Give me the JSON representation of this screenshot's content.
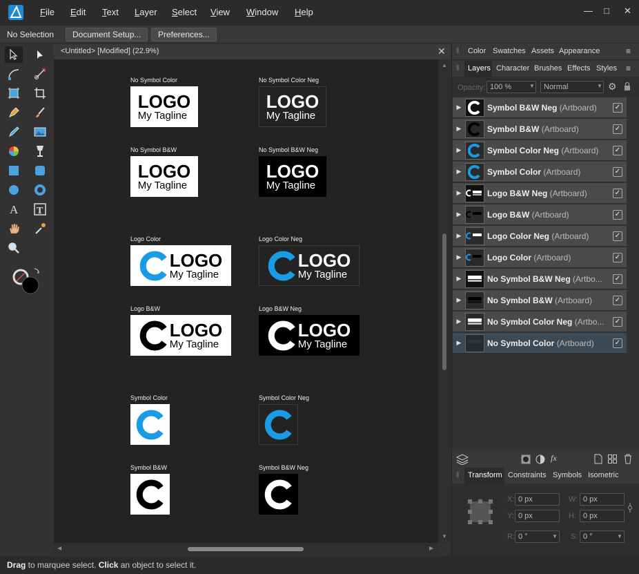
{
  "menu": {
    "items": [
      "File",
      "Edit",
      "Text",
      "Layer",
      "Select",
      "View",
      "Window",
      "Help"
    ],
    "underline": [
      "F",
      "E",
      "T",
      "L",
      "S",
      "V",
      "W",
      "H"
    ]
  },
  "window": {
    "minimize": "—",
    "maximize": "□",
    "close": "✕"
  },
  "context": {
    "selection": "No Selection",
    "doc_setup": "Document Setup...",
    "preferences": "Preferences..."
  },
  "document": {
    "tab_title": "<Untitled> [Modified] (22.9%)",
    "close": "✕"
  },
  "artboards": [
    {
      "label": "No Symbol Color"
    },
    {
      "label": "No Symbol Color Neg"
    },
    {
      "label": "No Symbol B&W"
    },
    {
      "label": "No Symbol B&W Neg"
    },
    {
      "label": "Logo Color"
    },
    {
      "label": "Logo Color Neg"
    },
    {
      "label": "Logo B&W"
    },
    {
      "label": "Logo B&W Neg"
    },
    {
      "label": "Symbol Color"
    },
    {
      "label": "Symbol Color Neg"
    },
    {
      "label": "Symbol B&W"
    },
    {
      "label": "Symbol B&W Neg"
    }
  ],
  "logo": {
    "word": "LOGO",
    "tagline": "My Tagline"
  },
  "colors": {
    "accent": "#1a9be6",
    "bg_dark": "#232323",
    "white": "#ffffff",
    "black": "#000000"
  },
  "panels": {
    "top_tabs": [
      "Color",
      "Swatches",
      "Assets",
      "Appearance"
    ],
    "layer_tabs": [
      "Layers",
      "Character",
      "Brushes",
      "Effects",
      "Styles"
    ],
    "opacity_label": "Opacity:",
    "opacity_value": "100 %",
    "blend_mode": "Normal",
    "layers": [
      {
        "name": "Symbol B&W Neg",
        "kind": "(Artboard)"
      },
      {
        "name": "Symbol B&W",
        "kind": "(Artboard)"
      },
      {
        "name": "Symbol Color Neg",
        "kind": "(Artboard)"
      },
      {
        "name": "Symbol Color",
        "kind": "(Artboard)"
      },
      {
        "name": "Logo B&W Neg",
        "kind": "(Artboard)"
      },
      {
        "name": "Logo B&W",
        "kind": "(Artboard)"
      },
      {
        "name": "Logo Color Neg",
        "kind": "(Artboard)"
      },
      {
        "name": "Logo Color",
        "kind": "(Artboard)"
      },
      {
        "name": "No Symbol B&W Neg",
        "kind": "(Artbo..."
      },
      {
        "name": "No Symbol B&W",
        "kind": "(Artboard)"
      },
      {
        "name": "No Symbol Color Neg",
        "kind": "(Artbo..."
      },
      {
        "name": "No Symbol Color",
        "kind": "(Artboard)"
      }
    ],
    "bottom_tabs": [
      "Transform",
      "Constraints",
      "Symbols",
      "Isometric"
    ],
    "transform": {
      "x_label": "X:",
      "x": "0 px",
      "w_label": "W:",
      "w": "0 px",
      "y_label": "Y:",
      "y": "0 px",
      "h_label": "H:",
      "h": "0 px",
      "r_label": "R:",
      "r": "0 °",
      "s_label": "S:",
      "s": "0 °"
    }
  },
  "status": {
    "drag": "Drag",
    "text1": " to marquee select. ",
    "click": "Click",
    "text2": " an object to select it."
  }
}
